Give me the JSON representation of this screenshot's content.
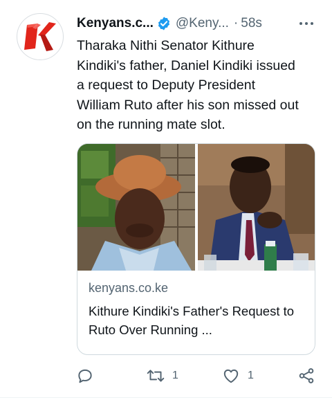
{
  "tweet": {
    "author_name": "Kenyans.c...",
    "author_handle": "@Keny...",
    "separator": "·",
    "time": "58s",
    "text": "Tharaka Nithi Senator Kithure\nKindiki's father, Daniel Kindiki issued\na request to Deputy President\nWilliam Ruto after his son missed out\non the running mate slot.",
    "avatar_letter": "K"
  },
  "card": {
    "domain": "kenyans.co.ke",
    "title": "Kithure Kindiki's Father's Request to Ruto Over Running ..."
  },
  "actions": {
    "reply_icon": "reply-icon",
    "retweet_count": "1",
    "like_count": "1",
    "share_icon": "share-icon"
  },
  "colors": {
    "brand_red": "#e1251b",
    "verified_blue": "#1d9bf0",
    "secondary_text": "#536471",
    "primary_text": "#0f1419"
  }
}
